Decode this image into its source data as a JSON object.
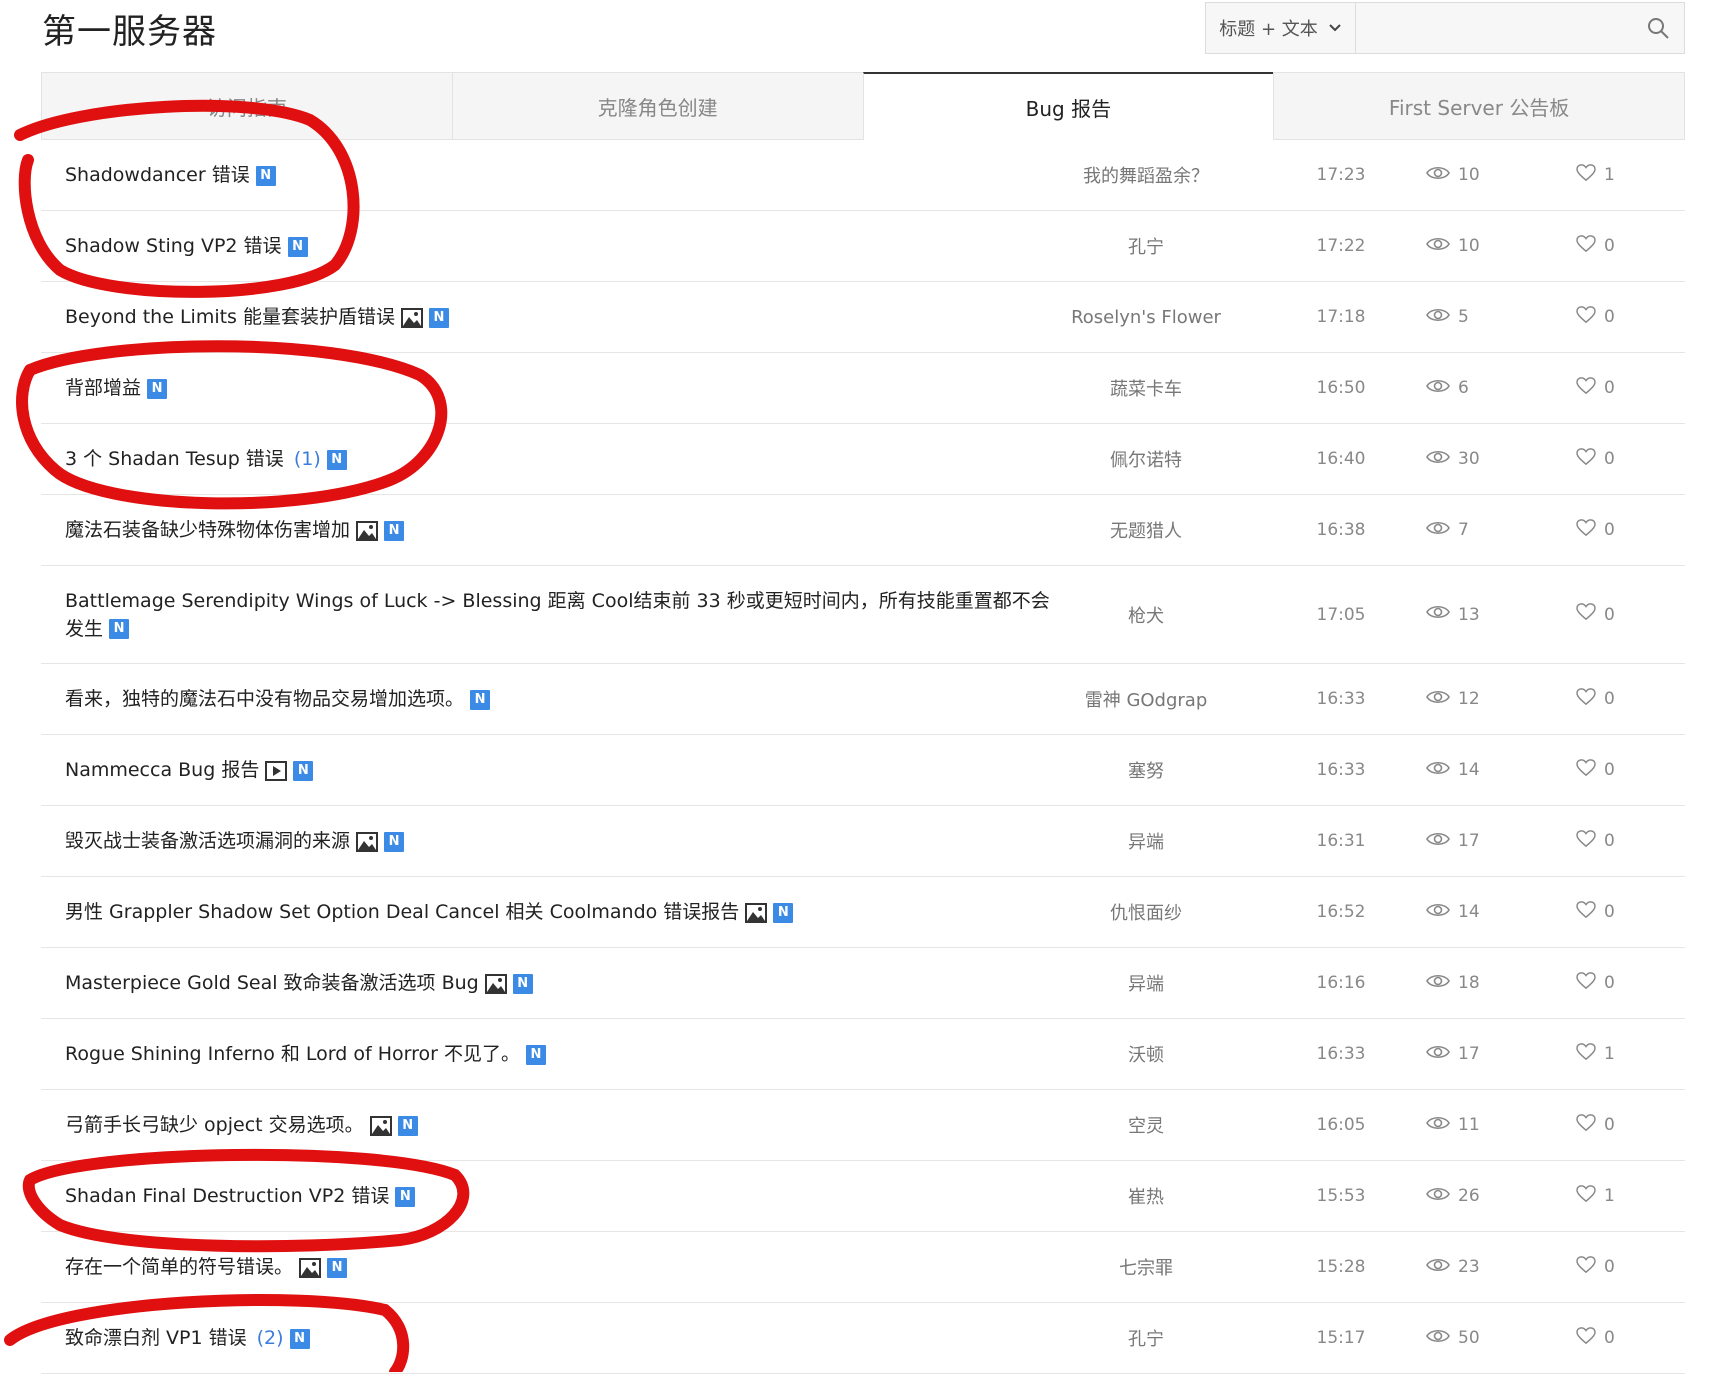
{
  "header": {
    "title": "第一服务器",
    "search_scope": "标题 + 文本",
    "search_placeholder": ""
  },
  "tabs": [
    {
      "label": "访问指南",
      "active": false
    },
    {
      "label": "克隆角色创建",
      "active": false
    },
    {
      "label": "Bug 报告",
      "active": true
    },
    {
      "label": "First Server 公告板",
      "active": false
    }
  ],
  "posts": [
    {
      "title": "Shadowdancer 错误",
      "comments": "",
      "has_image": false,
      "has_video": false,
      "author": "我的舞蹈盈余？",
      "time": "17:23",
      "views": "10",
      "likes": "1"
    },
    {
      "title": "Shadow Sting VP2 错误",
      "comments": "",
      "has_image": false,
      "has_video": false,
      "author": "孔宁",
      "time": "17:22",
      "views": "10",
      "likes": "0"
    },
    {
      "title": "Beyond the Limits 能量套装护盾错误",
      "comments": "",
      "has_image": true,
      "has_video": false,
      "author": "Roselyn's Flower",
      "time": "17:18",
      "views": "5",
      "likes": "0"
    },
    {
      "title": "背部增益",
      "comments": "",
      "has_image": false,
      "has_video": false,
      "author": "蔬菜卡车",
      "time": "16:50",
      "views": "6",
      "likes": "0"
    },
    {
      "title": "3 个 Shadan Tesup 错误",
      "comments": "(1)",
      "has_image": false,
      "has_video": false,
      "author": "佩尔诺特",
      "time": "16:40",
      "views": "30",
      "likes": "0"
    },
    {
      "title": "魔法石装备缺少特殊物体伤害增加",
      "comments": "",
      "has_image": true,
      "has_video": false,
      "author": "无题猎人",
      "time": "16:38",
      "views": "7",
      "likes": "0"
    },
    {
      "title": "Battlemage Serendipity Wings of Luck -> Blessing 距离 Cool结束前 33 秒或更短时间内，所有技能重置都不会发生",
      "comments": "",
      "has_image": false,
      "has_video": false,
      "author": "枪犬",
      "time": "17:05",
      "views": "13",
      "likes": "0",
      "tall": true
    },
    {
      "title": "看来，独特的魔法石中没有物品交易增加选项。",
      "comments": "",
      "has_image": false,
      "has_video": false,
      "author": "雷神 GOdgrap",
      "time": "16:33",
      "views": "12",
      "likes": "0"
    },
    {
      "title": "Nammecca Bug 报告",
      "comments": "",
      "has_image": false,
      "has_video": true,
      "author": "塞努",
      "time": "16:33",
      "views": "14",
      "likes": "0"
    },
    {
      "title": "毁灭战士装备激活选项漏洞的来源",
      "comments": "",
      "has_image": true,
      "has_video": false,
      "author": "异端",
      "time": "16:31",
      "views": "17",
      "likes": "0"
    },
    {
      "title": "男性 Grappler Shadow Set Option Deal Cancel 相关 Coolmando 错误报告",
      "comments": "",
      "has_image": true,
      "has_video": false,
      "author": "仇恨面纱",
      "time": "16:52",
      "views": "14",
      "likes": "0"
    },
    {
      "title": "Masterpiece Gold Seal 致命装备激活选项 Bug",
      "comments": "",
      "has_image": true,
      "has_video": false,
      "author": "异端",
      "time": "16:16",
      "views": "18",
      "likes": "0"
    },
    {
      "title": "Rogue Shining Inferno 和 Lord of Horror 不见了。",
      "comments": "",
      "has_image": false,
      "has_video": false,
      "author": "沃顿",
      "time": "16:33",
      "views": "17",
      "likes": "1"
    },
    {
      "title": "弓箭手长弓缺少 opject 交易选项。",
      "comments": "",
      "has_image": true,
      "has_video": false,
      "author": "空灵",
      "time": "16:05",
      "views": "11",
      "likes": "0"
    },
    {
      "title": "Shadan Final Destruction VP2 错误",
      "comments": "",
      "has_image": false,
      "has_video": false,
      "author": "崔热",
      "time": "15:53",
      "views": "26",
      "likes": "1"
    },
    {
      "title": "存在一个简单的符号错误。",
      "comments": "",
      "has_image": true,
      "has_video": false,
      "author": "七宗罪",
      "time": "15:28",
      "views": "23",
      "likes": "0"
    },
    {
      "title": "致命漂白剂 VP1 错误",
      "comments": "(2)",
      "has_image": false,
      "has_video": false,
      "author": "孔宁",
      "time": "15:17",
      "views": "50",
      "likes": "0"
    }
  ],
  "badge_new_label": "N",
  "colors": {
    "accent": "#3b8be6",
    "annotation": "#e01010"
  }
}
